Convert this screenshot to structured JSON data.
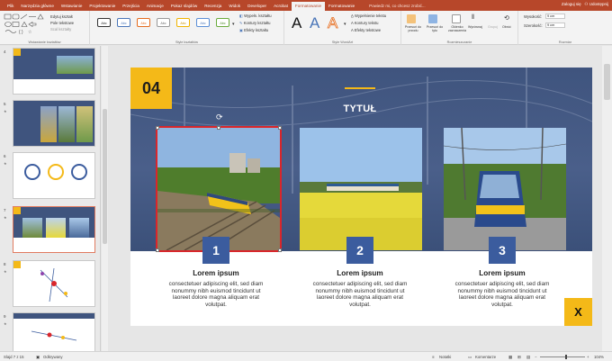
{
  "tabs": [
    "Plik",
    "Narzędzia główne",
    "Wstawianie",
    "Projektowanie",
    "Przejścia",
    "Animacje",
    "Pokaz slajdów",
    "Recenzja",
    "Widok",
    "Developer",
    "Acrobat",
    "Formatowanie",
    "Formatowanie"
  ],
  "tell_me": "Powiedz mi, co chcesz zrobić...",
  "account": {
    "signin": "Zaloguj się",
    "share": "Udostępnij"
  },
  "ribbon": {
    "insert_shapes": {
      "label": "Wstawianie kształtów",
      "edit_shape": "Edytuj kształt",
      "text_box": "Pole tekstowe",
      "merge_shapes": "Scal kształty"
    },
    "shape_styles": {
      "label": "Style kształtów",
      "swatches": [
        "Abc",
        "Abc",
        "Abc",
        "Abc",
        "Abc",
        "Abc",
        "Abc"
      ],
      "fill": "Wypełn. kształtu",
      "outline": "Kontury kształtu",
      "effects": "Efekty kształtu"
    },
    "wordart_styles": {
      "label": "Style WordArt",
      "letters": [
        "A",
        "A",
        "A"
      ],
      "text_fill": "Wypełnienie tekstu",
      "text_outline": "Kontury tekstu",
      "text_effects": "Efekty tekstowe"
    },
    "arrange": {
      "label": "Rozmieszczanie",
      "bring_forward": "Przesuń do przodu",
      "send_backward": "Przesuń do tyłu",
      "selection_pane": "Okienko zaznaczenia",
      "align": "Wyrównaj",
      "group": "Grupuj",
      "rotate": "Obróć"
    },
    "size": {
      "label": "Rozmiar",
      "height_label": "Wysokość:",
      "height_value": "9 cm",
      "width_label": "Szerokość:",
      "width_value": "9 cm"
    }
  },
  "thumbnails": [
    {
      "num": "4"
    },
    {
      "num": "5"
    },
    {
      "num": "6"
    },
    {
      "num": "7"
    },
    {
      "num": "8"
    },
    {
      "num": "9"
    }
  ],
  "slide": {
    "number": "04",
    "title": "TYTUŁ",
    "close": "X",
    "columns": [
      {
        "num": "1",
        "heading": "Lorem ipsum",
        "body": "consectetuer adipiscing elit, sed diam\nnonummy nibh euismod tincidunt ut\nlaoreet dolore magna aliquam erat\nvolutpat."
      },
      {
        "num": "2",
        "heading": "Lorem ipsum",
        "body": "consectetuer adipiscing elit, sed diam\nnonummy nibh euismod tincidunt ut\nlaoreet dolore magna aliquam erat\nvolutpat."
      },
      {
        "num": "3",
        "heading": "Lorem ipsum",
        "body": "consectetuer adipiscing elit, sed diam\nnonummy nibh euismod tincidunt ut\nlaoreet dolore magna aliquam erat\nvolutpat."
      }
    ]
  },
  "statusbar": {
    "slide_info": "Slajd 7 z 15",
    "language": "Odkrywany",
    "notes": "Notatki",
    "comments": "Komentarze",
    "zoom": "104%"
  },
  "colors": {
    "brand_ribbon": "#b7472a",
    "slide_accent_yellow": "#f4b918",
    "slide_tile_blue": "#3b5c9e",
    "selection_red": "#d9262b"
  }
}
